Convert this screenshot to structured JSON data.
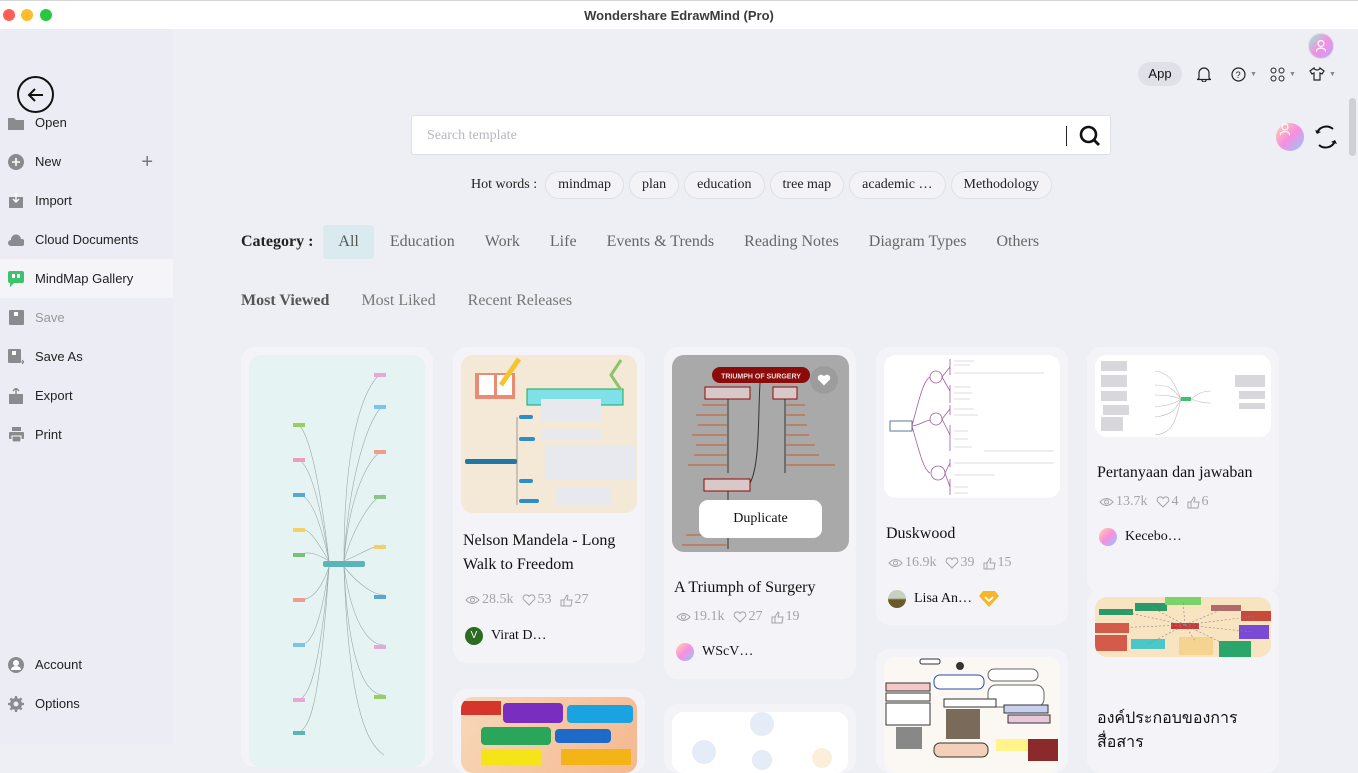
{
  "window": {
    "title": "Wondershare EdrawMind (Pro)"
  },
  "sidebar": {
    "items": [
      {
        "label": "Open",
        "icon": "folder-icon"
      },
      {
        "label": "New",
        "icon": "plus-circle-icon"
      },
      {
        "label": "Import",
        "icon": "import-icon"
      },
      {
        "label": "Cloud Documents",
        "icon": "cloud-icon"
      },
      {
        "label": "MindMap Gallery",
        "icon": "gallery-icon",
        "active": true
      },
      {
        "label": "Save",
        "icon": "save-icon",
        "disabled": true
      },
      {
        "label": "Save As",
        "icon": "save-as-icon"
      },
      {
        "label": "Export",
        "icon": "export-icon"
      },
      {
        "label": "Print",
        "icon": "printer-icon"
      }
    ],
    "bottom": [
      {
        "label": "Account",
        "icon": "account-icon"
      },
      {
        "label": "Options",
        "icon": "gear-icon"
      }
    ],
    "new_plus": "+"
  },
  "header": {
    "app_label": "App"
  },
  "search": {
    "placeholder": "Search template"
  },
  "hot_words": {
    "label": "Hot words :",
    "items": [
      "mindmap",
      "plan",
      "education",
      "tree map",
      "academic …",
      "Methodology"
    ]
  },
  "category": {
    "label": "Category :",
    "items": [
      "All",
      "Education",
      "Work",
      "Life",
      "Events & Trends",
      "Reading Notes",
      "Diagram Types",
      "Others"
    ],
    "selected": "All"
  },
  "sort": {
    "items": [
      "Most Viewed",
      "Most Liked",
      "Recent Releases"
    ],
    "selected": "Most Viewed"
  },
  "cards": [
    {
      "title": "Nelson Mandela - Long Walk to Freedom",
      "views": "28.5k",
      "likes": "53",
      "thumbs": "27",
      "author": "Virat D…",
      "avatar_letter": "V"
    },
    {
      "title": "A Triumph of Surgery",
      "views": "19.1k",
      "likes": "27",
      "thumbs": "19",
      "author": "WScV…",
      "duplicate_label": "Duplicate",
      "thumb_heading": "TRIUMPH OF SURGERY"
    },
    {
      "title": "Duskwood",
      "views": "16.9k",
      "likes": "39",
      "thumbs": "15",
      "author": "Lisa An…"
    },
    {
      "title": "Pertanyaan dan jawaban",
      "views": "13.7k",
      "likes": "4",
      "thumbs": "6",
      "author": "Kecebo…"
    },
    {
      "title": "องค์ประกอบของการสื่อสาร"
    }
  ],
  "colors": {
    "accent_selected_bg": "#d9ebee",
    "gallery_green": "#3cc46c",
    "badge_orange": "#f5b629"
  }
}
